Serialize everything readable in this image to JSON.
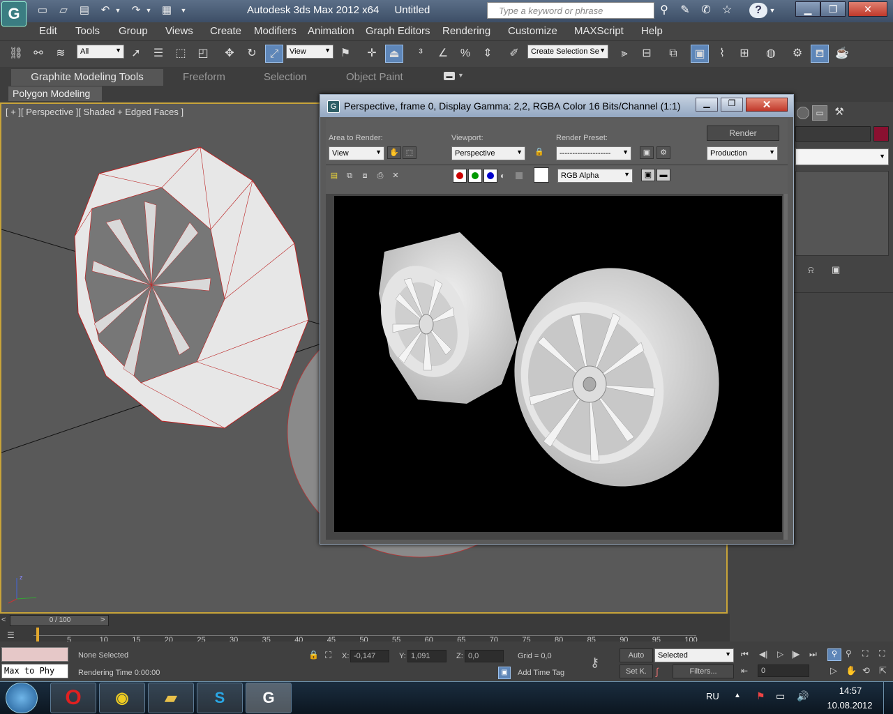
{
  "titlebar": {
    "app_title": "Autodesk 3ds Max  2012 x64",
    "doc_title": "Untitled",
    "search_placeholder": "Type a keyword or phrase"
  },
  "menu": [
    "Edit",
    "Tools",
    "Group",
    "Views",
    "Create",
    "Modifiers",
    "Animation",
    "Graph Editors",
    "Rendering",
    "Customize",
    "MAXScript",
    "Help"
  ],
  "toolbar": {
    "selection_filter": "All",
    "reference_coord": "View",
    "named_selection": "Create Selection Se"
  },
  "ribbon": {
    "tabs": [
      "Graphite Modeling Tools",
      "Freeform",
      "Selection",
      "Object Paint"
    ],
    "subtab": "Polygon Modeling"
  },
  "viewport": {
    "label": "[ + ][ Perspective ][ Shaded + Edged Faces ]"
  },
  "render_window": {
    "title": "Perspective, frame 0, Display Gamma: 2,2, RGBA Color 16 Bits/Channel (1:1)",
    "area_to_render_label": "Area to Render:",
    "area_to_render_value": "View",
    "viewport_label": "Viewport:",
    "viewport_value": "Perspective",
    "render_preset_label": "Render Preset:",
    "render_preset_value": "--------------------",
    "render_button": "Render",
    "production_value": "Production",
    "channel_value": "RGB Alpha",
    "accent_red": "#cc0000",
    "accent_green": "#009900",
    "accent_blue": "#0000cc"
  },
  "timeline": {
    "frame_counter": "0 / 100",
    "ruler": [
      "5",
      "10",
      "15",
      "20",
      "25",
      "30",
      "35",
      "40",
      "45",
      "50",
      "55",
      "60",
      "65",
      "70",
      "75",
      "80",
      "85",
      "90",
      "95",
      "100"
    ]
  },
  "status": {
    "selection_text": "None Selected",
    "prompt_text": "Rendering Time  0:00:00",
    "script_listener": "Max to Phy",
    "x_label": "X:",
    "x_value": "-0,147",
    "y_label": "Y:",
    "y_value": "1,091",
    "z_label": "Z:",
    "z_value": "0,0",
    "grid_text": "Grid = 0,0",
    "add_time_tag": "Add Time Tag",
    "auto_key": "Auto",
    "set_key": "Set K.",
    "key_filter": "Selected",
    "filters": "Filters...",
    "current_frame": "0"
  },
  "taskbar": {
    "language": "RU",
    "time": "14:57",
    "date": "10.08.2012"
  }
}
